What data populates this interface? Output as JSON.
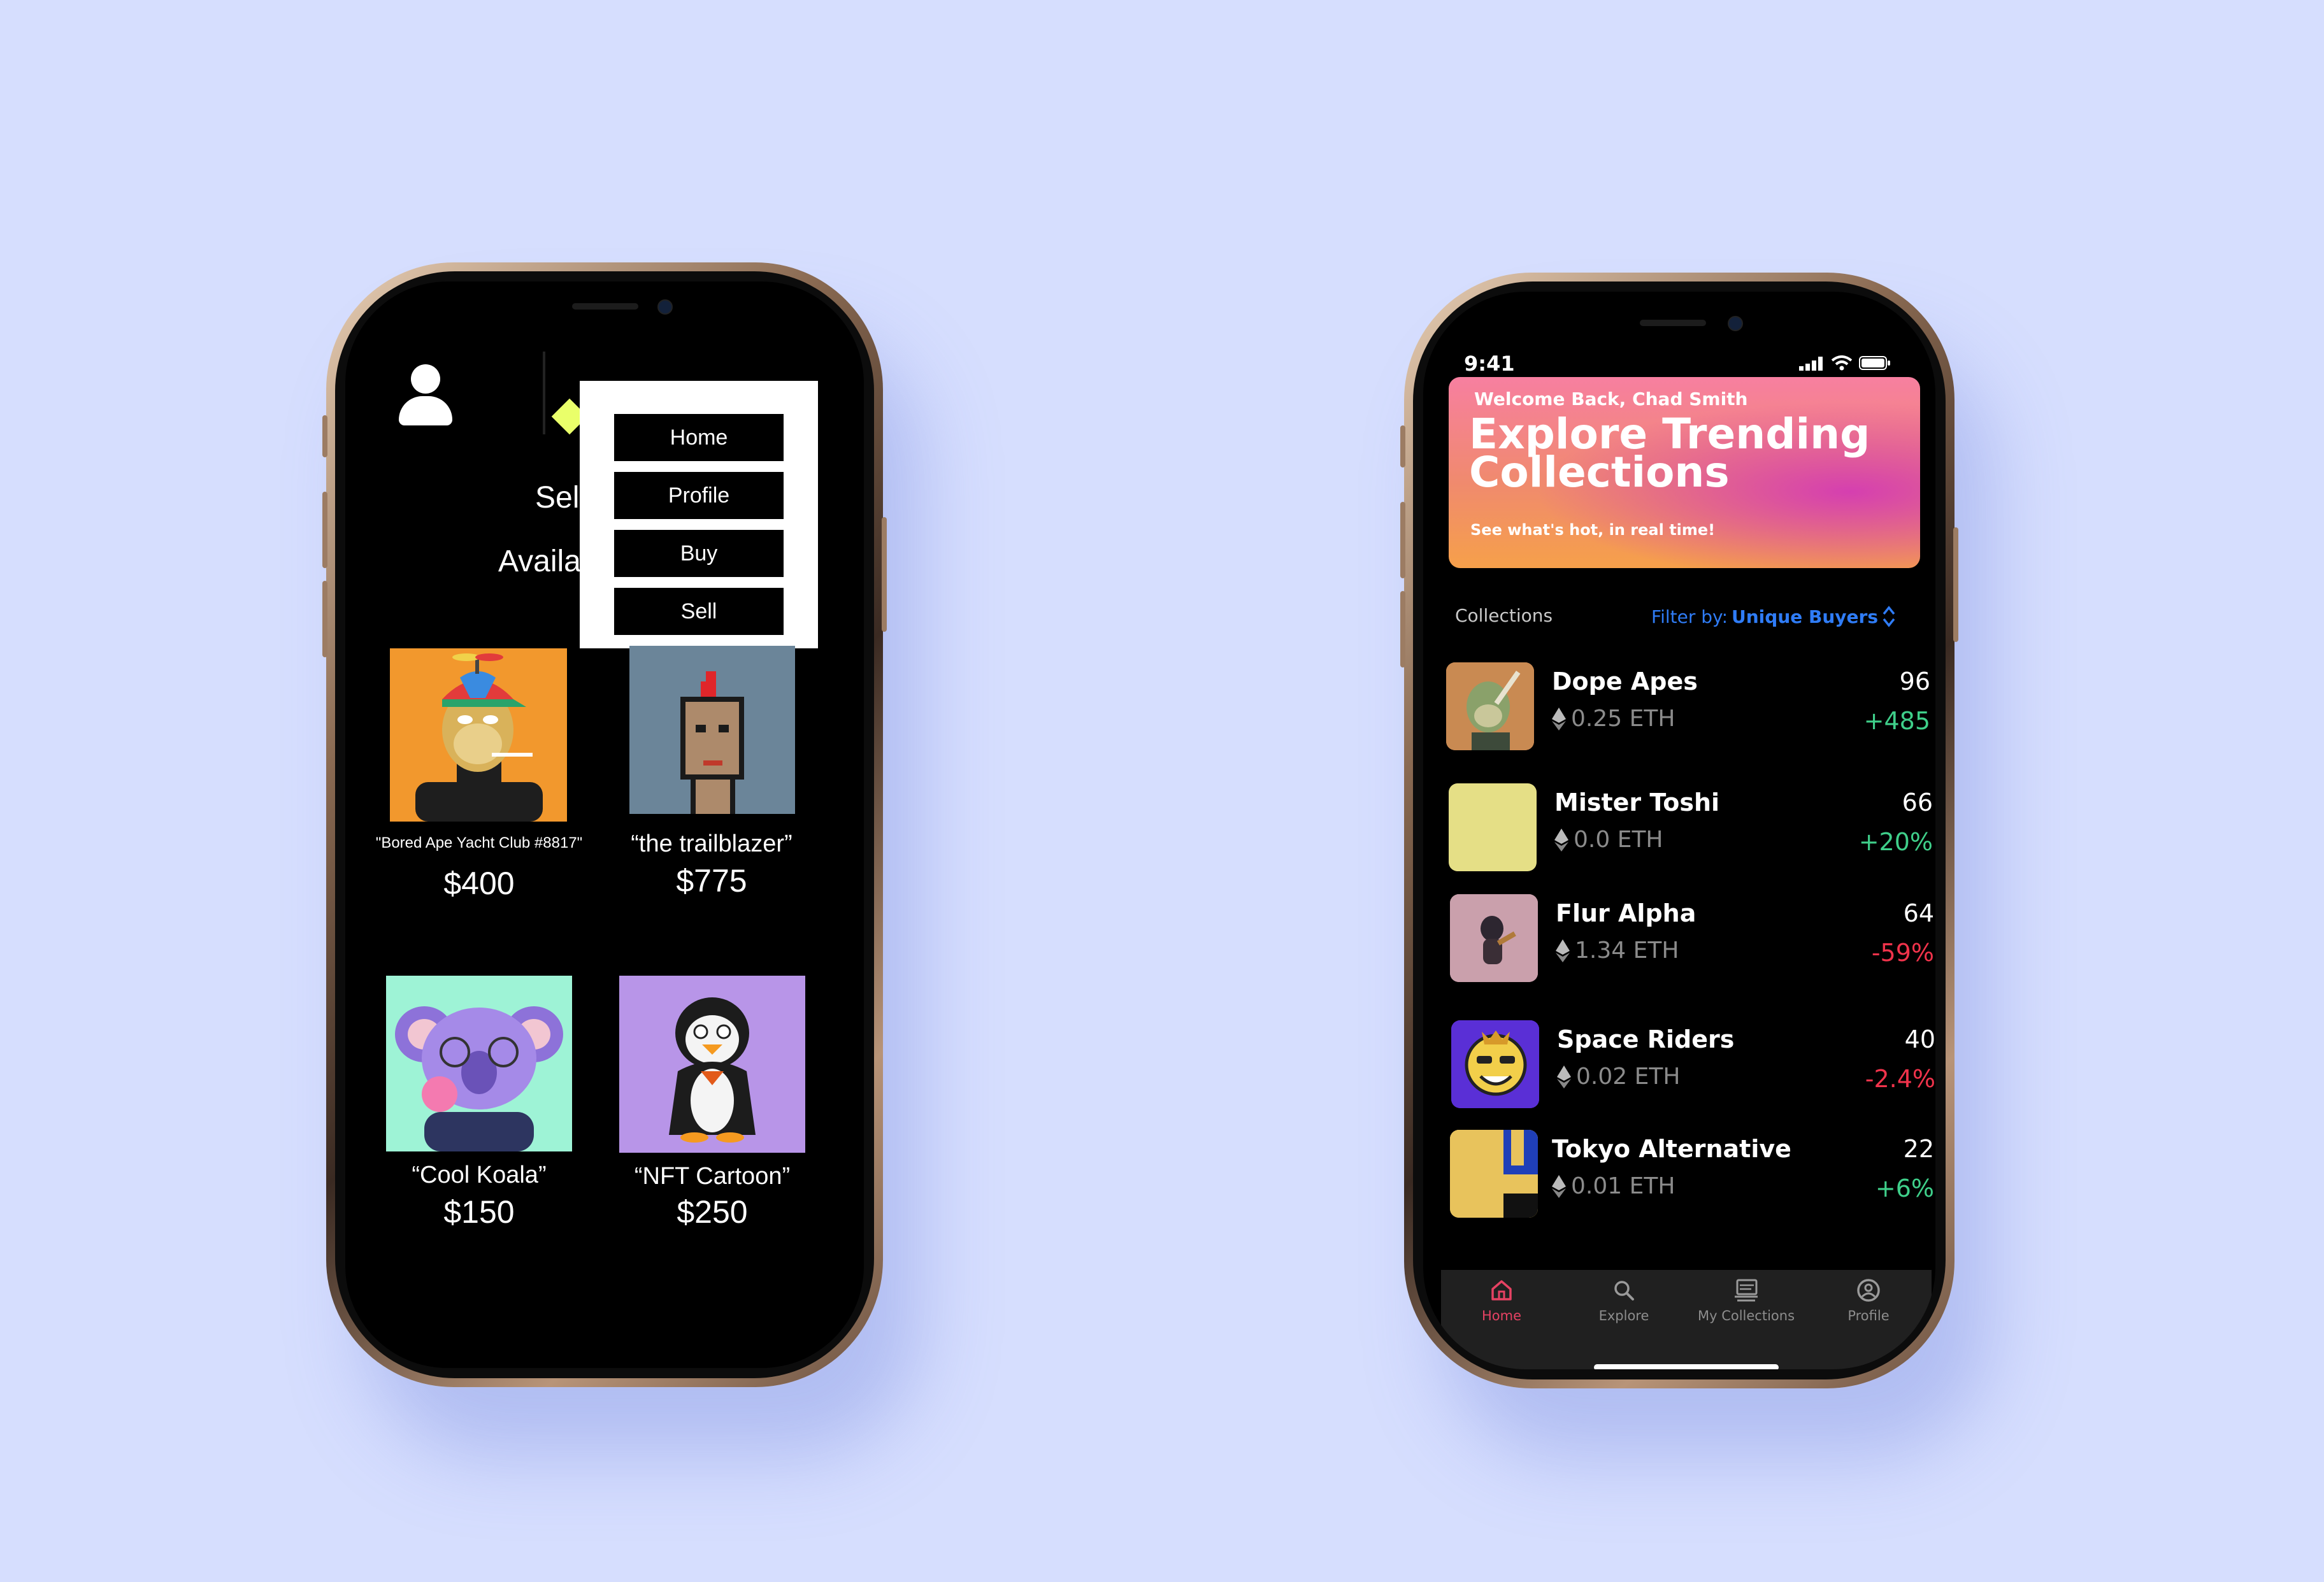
{
  "phone1": {
    "menu": {
      "items": [
        "Home",
        "Profile",
        "Buy",
        "Sell"
      ]
    },
    "hidden_heading_1": "Sel",
    "hidden_heading_2": "Availa",
    "nfts": [
      {
        "title": "\"Bored Ape Yacht Club #8817\"",
        "price": "$400"
      },
      {
        "title": "“the trailblazer”",
        "price": "$775"
      },
      {
        "title": "“Cool Koala”",
        "price": "$150"
      },
      {
        "title": "“NFT Cartoon”",
        "price": "$250"
      }
    ]
  },
  "phone2": {
    "status": {
      "time": "9:41"
    },
    "hero": {
      "welcome": "Welcome Back, Chad Smith",
      "title": "Explore Trending Collections",
      "subtitle": "See what's hot, in real time!"
    },
    "collections_label": "Collections",
    "filter": {
      "label": "Filter by:",
      "value": "Unique Buyers"
    },
    "collections": [
      {
        "name": "Dope Apes",
        "price": "0.25 ETH",
        "count": "96",
        "change": "+485",
        "trend": "up"
      },
      {
        "name": "Mister Toshi",
        "price": "0.0 ETH",
        "count": "66",
        "change": "+20%",
        "trend": "up"
      },
      {
        "name": "Flur Alpha",
        "price": "1.34 ETH",
        "count": "64",
        "change": "-59%",
        "trend": "down"
      },
      {
        "name": "Space Riders",
        "price": "0.02 ETH",
        "count": "40",
        "change": "-2.4%",
        "trend": "down"
      },
      {
        "name": "Tokyo Alternative",
        "price": "0.01 ETH",
        "count": "22",
        "change": "+6%",
        "trend": "up"
      }
    ],
    "tabs": [
      {
        "label": "Home",
        "icon": "home-icon",
        "active": true
      },
      {
        "label": "Explore",
        "icon": "search-icon",
        "active": false
      },
      {
        "label": "My Collections",
        "icon": "collections-icon",
        "active": false
      },
      {
        "label": "Profile",
        "icon": "profile-icon",
        "active": false
      }
    ]
  },
  "colors": {
    "background": "#d6defe",
    "accent_blue": "#2f7cf6",
    "positive": "#3fcf8a",
    "negative": "#f0334b",
    "tab_active": "#e64263",
    "menu_highlight": "#eaff6a"
  }
}
